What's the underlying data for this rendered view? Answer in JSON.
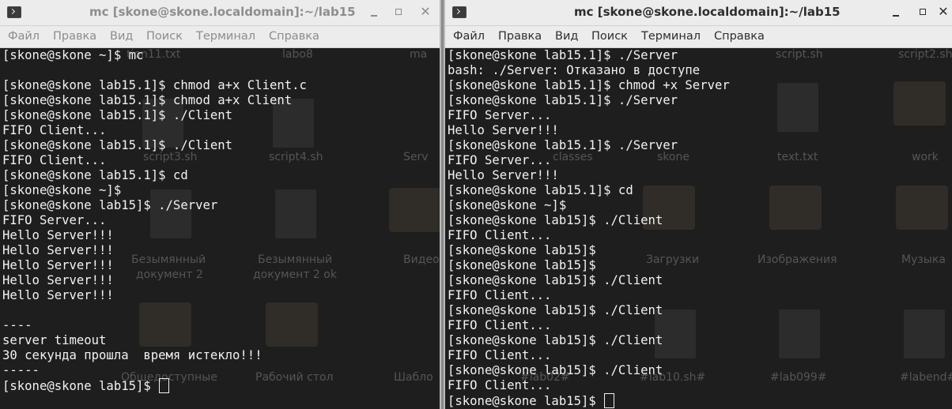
{
  "windows": [
    {
      "title": "mc [skone@skone.localdomain]:~/lab15",
      "menu": [
        "Файл",
        "Правка",
        "Вид",
        "Поиск",
        "Терминал",
        "Справка"
      ],
      "lines": [
        "[skone@skone ~]$ mc",
        "",
        "[skone@skone lab15.1]$ chmod a+x Client.c",
        "[skone@skone lab15.1]$ chmod a+x Client",
        "[skone@skone lab15.1]$ ./Client",
        "FIFO Client...",
        "[skone@skone lab15.1]$ ./Client",
        "FIFO Client...",
        "[skone@skone lab15.1]$ cd",
        "[skone@skone ~]$",
        "[skone@skone lab15]$ ./Server",
        "FIFO Server...",
        "Hello Server!!!",
        "Hello Server!!!",
        "Hello Server!!!",
        "Hello Server!!!",
        "Hello Server!!!",
        "",
        "----",
        "server timeout",
        "30 секунда прошла  время истекло!!!",
        "-----"
      ],
      "prompt": "[skone@skone lab15]$ "
    },
    {
      "title": "mc [skone@skone.localdomain]:~/lab15",
      "menu": [
        "Файл",
        "Правка",
        "Вид",
        "Поиск",
        "Терминал",
        "Справка"
      ],
      "lines": [
        "[skone@skone lab15.1]$ ./Server",
        "bash: ./Server: Отказано в доступе",
        "[skone@skone lab15.1]$ chmod +x Server",
        "[skone@skone lab15.1]$ ./Server",
        "FIFO Server...",
        "Hello Server!!!",
        "[skone@skone lab15.1]$ ./Server",
        "FIFO Server...",
        "Hello Server!!!",
        "[skone@skone lab15.1]$ cd",
        "[skone@skone ~]$",
        "[skone@skone lab15]$ ./Client",
        "FIFO Client...",
        "[skone@skone lab15]$",
        "[skone@skone lab15]$",
        "[skone@skone lab15]$ ./Client",
        "FIFO Client...",
        "[skone@skone lab15]$ ./Client",
        "FIFO Client...",
        "[skone@skone lab15]$ ./Client",
        "FIFO Client...",
        "[skone@skone lab15]$ ./Client",
        "FIFO Client..."
      ],
      "prompt": "[skone@skone lab15]$ "
    }
  ],
  "desktop_icons": {
    "left": [
      "tion11.txt",
      "labo8",
      "ma",
      "script3.sh",
      "script4.sh",
      "Serv",
      "Безымянный",
      "документ 2",
      "Безымянный",
      "документ 2 ok",
      "Видео",
      "Общедоступные",
      "Рабочий стол",
      "Шабло"
    ],
    "right": [
      "script.sh",
      "script2.sh",
      "classes",
      "skone",
      "text.txt",
      "work",
      "Загрузки",
      "Изображения",
      "Музыка",
      "#lab02#",
      "#lab10.sh#",
      "#lab099#",
      "#labend#"
    ]
  }
}
